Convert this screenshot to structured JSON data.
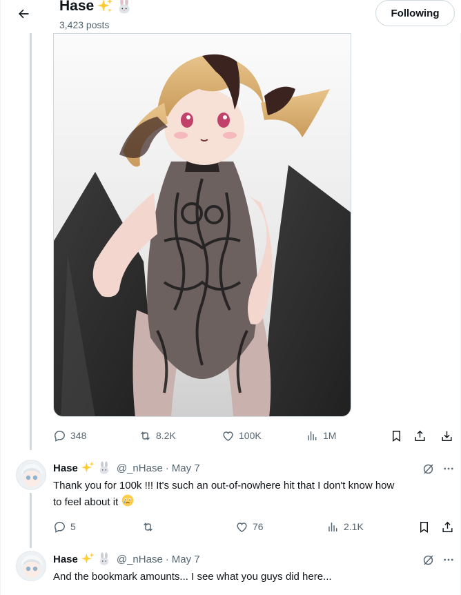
{
  "header": {
    "name": "Hase",
    "name_emojis": [
      "sparkles",
      "rabbit"
    ],
    "post_count": "3,423 posts",
    "follow_label": "Following"
  },
  "main_post": {
    "media_alt": "anime illustration of a blonde-haired girl in a black lace bodysuit and cape",
    "stats": {
      "replies": "348",
      "reposts": "8.2K",
      "likes": "100K",
      "views": "1M"
    }
  },
  "replies": [
    {
      "name": "Hase",
      "handle": "@_nHase",
      "separator": "·",
      "date": "May 7",
      "text_line1": "Thank you for 100k !!! It's such an out-of-nowhere hit that I don't know how",
      "text_line2": "to feel about it",
      "emoji": "face-holding-back-tears",
      "stats": {
        "replies": "5",
        "reposts": "",
        "likes": "76",
        "views": "2.1K"
      }
    },
    {
      "name": "Hase",
      "handle": "@_nHase",
      "separator": "·",
      "date": "May 7",
      "text_line1": "And the bookmark amounts... I see what you guys did here..."
    }
  ],
  "colors": {
    "text": "#0f1419",
    "secondary": "#536471",
    "border": "#cfd9de",
    "line": "#cfd9de"
  }
}
